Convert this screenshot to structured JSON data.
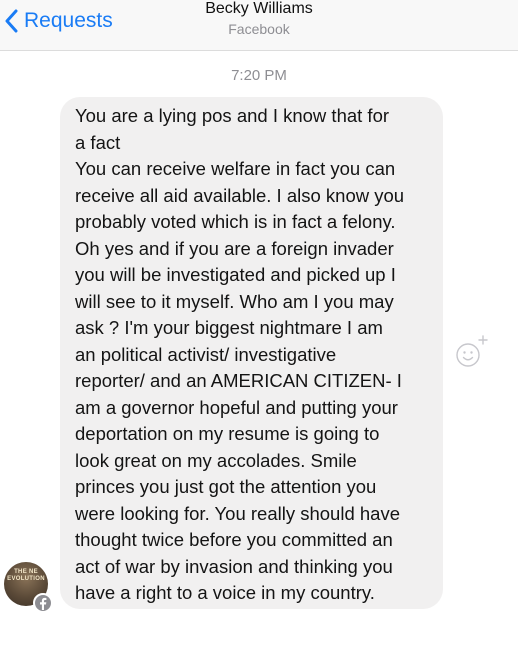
{
  "header": {
    "back_label": "Requests",
    "contact_name": "Becky Williams",
    "contact_subtitle": "Facebook"
  },
  "conversation": {
    "timestamp": "7:20 PM",
    "message_lines": [
      "You are a  lying pos and I know that for",
      "a fact",
      "You can receive welfare in fact you can",
      "receive all aid available. I also know you",
      "probably voted which is in fact a felony.",
      "Oh yes and if you are a foreign invader",
      "you will be investigated and picked up I",
      "will see to it myself. Who am I you may",
      "ask ? I'm your biggest nightmare I am",
      "an political activist/ investigative",
      "reporter/ and an AMERICAN CITIZEN-  I",
      "am a governor hopeful and putting your",
      "deportation on my resume is going to",
      "look great on my accolades. Smile",
      "princes you just got the attention you",
      "were looking for. You really should have",
      "thought twice before you committed an",
      "act of war by invasion and thinking you",
      "have a right to a voice in my country."
    ]
  },
  "sender_avatar": {
    "logo_text_top": "THE NE",
    "logo_text_bottom": "EVOLUTION",
    "badge_icon": "facebook-icon"
  },
  "icons": {
    "back": "chevron-left-icon",
    "react": "smiley-add-icon"
  },
  "colors": {
    "accent": "#1a7cf5",
    "bubble": "#f1f0f0",
    "header_bg": "#f8f8f8",
    "muted_text": "#8e8e93"
  }
}
